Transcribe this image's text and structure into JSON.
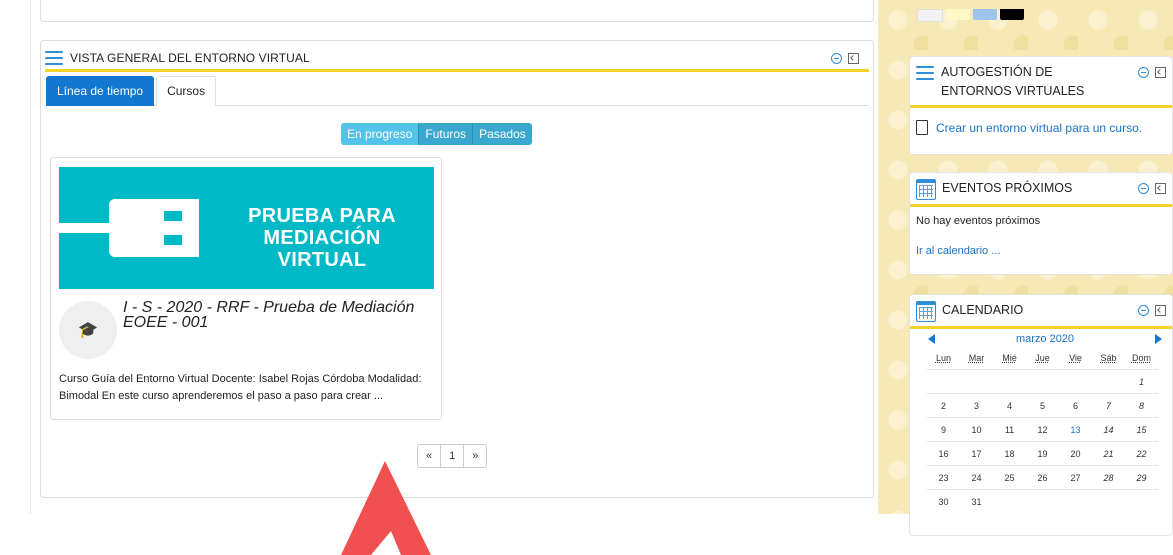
{
  "overview": {
    "title": "VISTA GENERAL DEL ENTORNO VIRTUAL",
    "tabs": [
      "Línea de tiempo",
      "Cursos"
    ],
    "filters": [
      "En progreso",
      "Futuros",
      "Pasados"
    ],
    "course": {
      "banner_line1": "PRUEBA PARA",
      "banner_line2": "MEDIACIÓN VIRTUAL",
      "title": "I - S - 2020 - RRF - Prueba de Mediación EOEE - 001",
      "summary": "Curso Guía del Entorno Virtual Docente: Isabel Rojas Córdoba Modalidad: Bimodal En este curso aprenderemos el paso a paso para crear ..."
    },
    "pagination": {
      "prev": "«",
      "page": "1",
      "next": "»"
    }
  },
  "swatch_colors": [
    "#f2f2f2",
    "#fff7c6",
    "#9cc6ee",
    "#000000"
  ],
  "autogestion": {
    "title": "AUTOGESTIÓN DE ENTORNOS VIRTUALES",
    "link": "Crear un entorno virtual para un curso."
  },
  "eventos": {
    "title": "EVENTOS PRÓXIMOS",
    "empty": "No hay eventos próximos",
    "link": "Ir al calendario ..."
  },
  "calendario": {
    "title": "CALENDARIO",
    "month": "marzo 2020",
    "weekdays": [
      "Lun",
      "Mar",
      "Mié",
      "Jue",
      "Vie",
      "Sáb",
      "Dom"
    ],
    "weeks": [
      [
        "",
        "",
        "",
        "",
        "",
        "",
        "1"
      ],
      [
        "2",
        "3",
        "4",
        "5",
        "6",
        "7",
        "8"
      ],
      [
        "9",
        "10",
        "11",
        "12",
        "13",
        "14",
        "15"
      ],
      [
        "16",
        "17",
        "18",
        "19",
        "20",
        "21",
        "22"
      ],
      [
        "23",
        "24",
        "25",
        "26",
        "27",
        "28",
        "29"
      ],
      [
        "30",
        "31",
        "",
        "",
        "",
        "",
        ""
      ]
    ],
    "today": "13"
  },
  "colors": {
    "accent": "#1177d1",
    "underline": "#f3d32b",
    "banner": "#00b9c6",
    "arrow": "#f0504f"
  }
}
